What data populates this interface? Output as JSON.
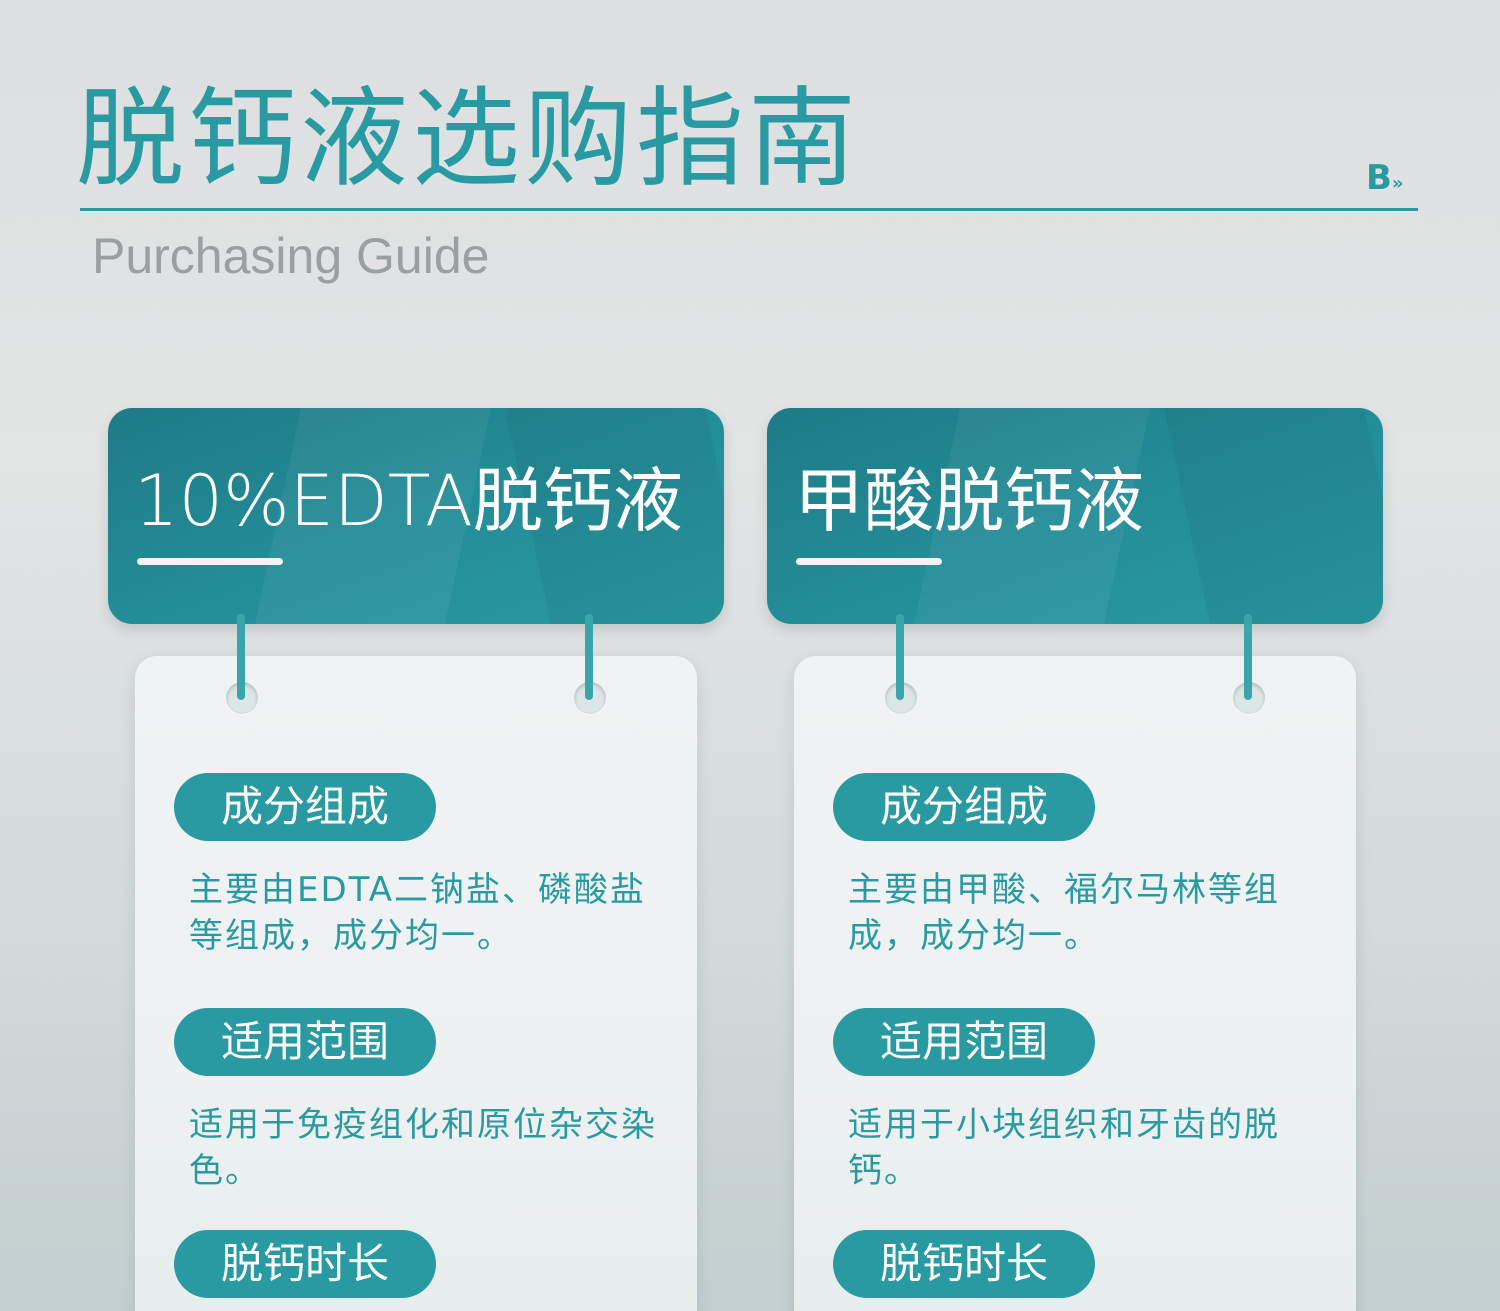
{
  "header": {
    "title": "脱钙液选购指南",
    "subtitle": "Purchasing Guide",
    "logo": "B",
    "logo_mark": "»"
  },
  "colors": {
    "accent": "#2a9aa2",
    "accent_dark": "#1e7a86",
    "subtitle": "#9a9fa0"
  },
  "products": [
    {
      "name": "10%EDTA脱钙液",
      "sections": [
        {
          "label": "成分组成",
          "text": "主要由EDTA二钠盐、磷酸盐等组成，成分均一。"
        },
        {
          "label": "适用范围",
          "text": "适用于免疫组化和原位杂交染色。"
        },
        {
          "label": "脱钙时长",
          "text": ""
        }
      ]
    },
    {
      "name": "甲酸脱钙液",
      "sections": [
        {
          "label": "成分组成",
          "text": "主要由甲酸、福尔马林等组成，成分均一。"
        },
        {
          "label": "适用范围",
          "text": "适用于小块组织和牙齿的脱钙。"
        },
        {
          "label": "脱钙时长",
          "text": ""
        }
      ]
    }
  ]
}
